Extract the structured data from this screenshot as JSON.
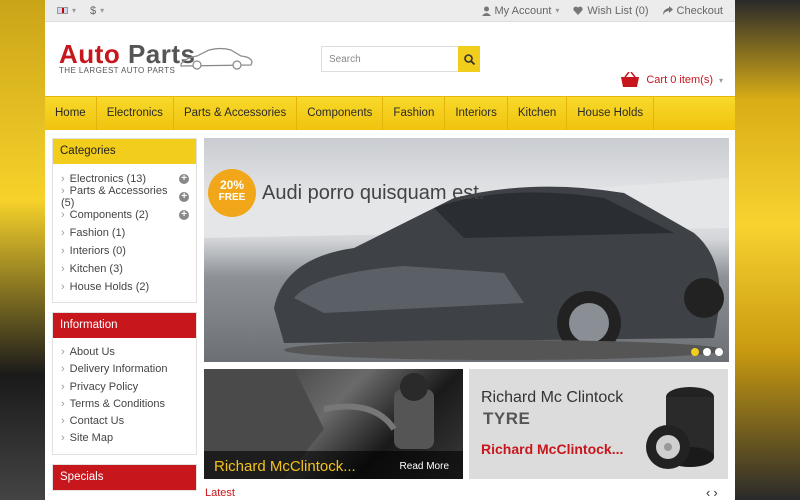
{
  "topbar": {
    "currency": "$",
    "account": "My Account",
    "wishlist": "Wish List (0)",
    "checkout": "Checkout"
  },
  "logo": {
    "title_red": "Auto",
    "title_gray": "Parts",
    "tagline": "THE LARGEST AUTO PARTS"
  },
  "search": {
    "placeholder": "Search"
  },
  "cart": {
    "label": "Cart 0 item(s)"
  },
  "nav": [
    "Home",
    "Electronics",
    "Parts & Accessories",
    "Components",
    "Fashion",
    "Interiors",
    "Kitchen",
    "House Holds"
  ],
  "categories": {
    "title": "Categories",
    "items": [
      {
        "label": "Electronics (13)",
        "expandable": true
      },
      {
        "label": "Parts & Accessories (5)",
        "expandable": true
      },
      {
        "label": "Components (2)",
        "expandable": true
      },
      {
        "label": "Fashion (1)",
        "expandable": false
      },
      {
        "label": "Interiors (0)",
        "expandable": false
      },
      {
        "label": "Kitchen (3)",
        "expandable": false
      },
      {
        "label": "House Holds (2)",
        "expandable": false
      }
    ]
  },
  "information": {
    "title": "Information",
    "items": [
      "About Us",
      "Delivery Information",
      "Privacy Policy",
      "Terms & Conditions",
      "Contact Us",
      "Site Map"
    ]
  },
  "specials": {
    "title": "Specials"
  },
  "slider": {
    "badge_pct": "20%",
    "badge_text": "FREE",
    "caption": "Audi porro quisquam est.",
    "dots": 3,
    "active_dot": 0
  },
  "banner1": {
    "title": "Richard McClintock...",
    "more": "Read More"
  },
  "banner2": {
    "line1": "Richard Mc Clintock",
    "line2": "TYRE",
    "line3": "Richard McClintock..."
  },
  "latest": {
    "title": "Latest"
  },
  "colors": {
    "accent_yellow": "#f2cd1b",
    "brand_red": "#c8161d"
  }
}
